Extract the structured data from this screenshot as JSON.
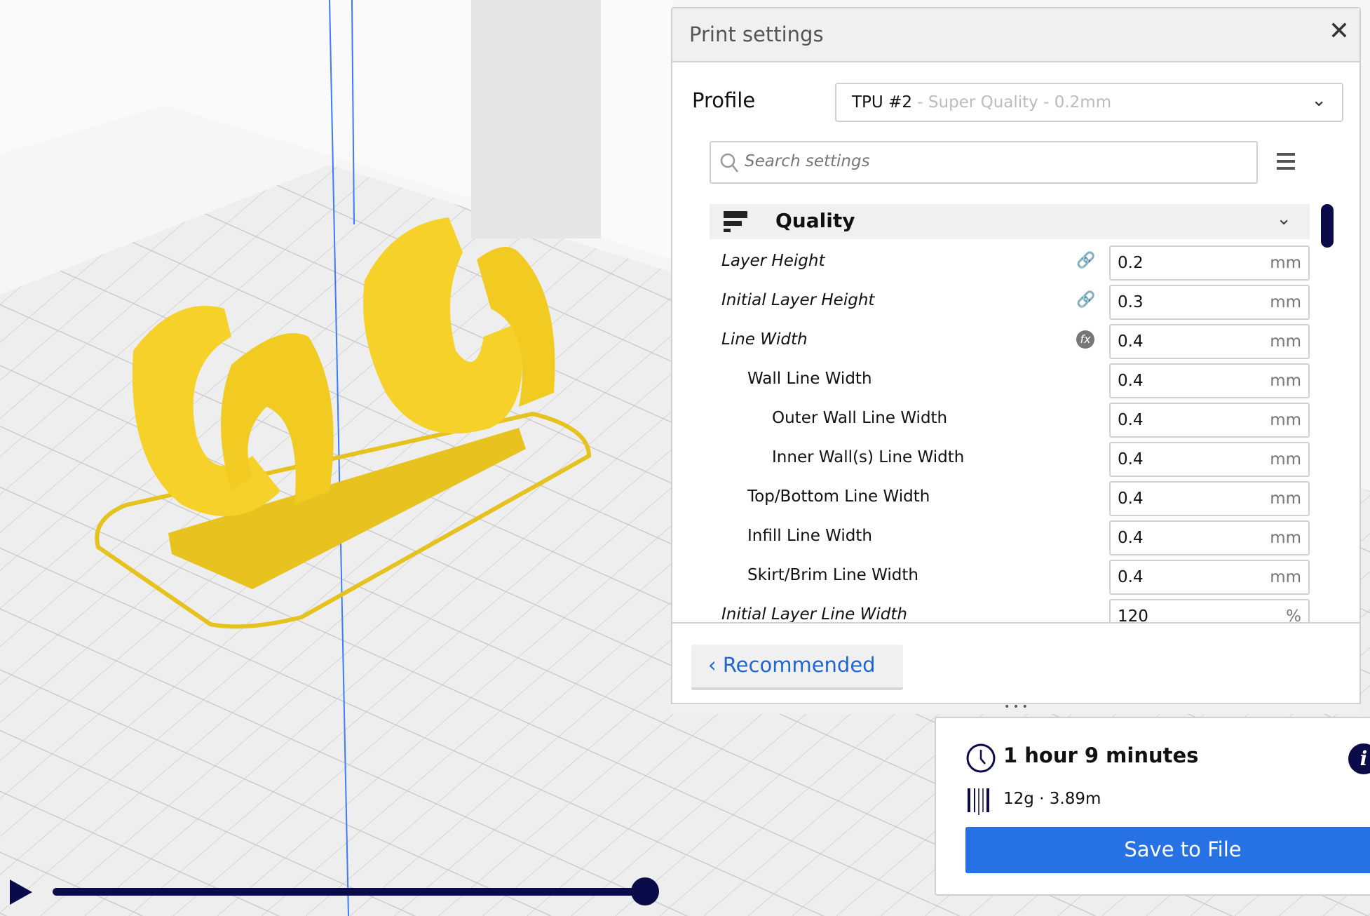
{
  "panel": {
    "title": "Print settings",
    "close_icon": "close-icon"
  },
  "profile": {
    "label": "Profile",
    "name": "TPU #2",
    "subtitle": " - Super Quality - 0.2mm"
  },
  "search": {
    "placeholder": "Search settings"
  },
  "category": {
    "title": "Quality"
  },
  "settings": [
    {
      "label": "Layer Height",
      "value": "0.2",
      "unit": "mm",
      "italic": true,
      "indent": 0,
      "icon": "link-icon"
    },
    {
      "label": "Initial Layer Height",
      "value": "0.3",
      "unit": "mm",
      "italic": true,
      "indent": 0,
      "icon": "link-icon"
    },
    {
      "label": "Line Width",
      "value": "0.4",
      "unit": "mm",
      "italic": true,
      "indent": 0,
      "icon": "function-icon"
    },
    {
      "label": "Wall Line Width",
      "value": "0.4",
      "unit": "mm",
      "italic": false,
      "indent": 1
    },
    {
      "label": "Outer Wall Line Width",
      "value": "0.4",
      "unit": "mm",
      "italic": false,
      "indent": 2
    },
    {
      "label": "Inner Wall(s) Line Width",
      "value": "0.4",
      "unit": "mm",
      "italic": false,
      "indent": 2
    },
    {
      "label": "Top/Bottom Line Width",
      "value": "0.4",
      "unit": "mm",
      "italic": false,
      "indent": 1
    },
    {
      "label": "Infill Line Width",
      "value": "0.4",
      "unit": "mm",
      "italic": false,
      "indent": 1
    },
    {
      "label": "Skirt/Brim Line Width",
      "value": "0.4",
      "unit": "mm",
      "italic": false,
      "indent": 1
    },
    {
      "label": "Initial Layer Line Width",
      "value": "120",
      "unit": "%",
      "italic": true,
      "indent": 0
    }
  ],
  "footer": {
    "recommended_label": "Recommended",
    "resize_handle": "• • •"
  },
  "summary": {
    "time": "1 hour 9 minutes",
    "material": "12g · 3.89m",
    "save_label": "Save to File"
  },
  "slider": {
    "progress": 1.0
  },
  "colors": {
    "accent": "#2671e3",
    "dark": "#0b0b4a",
    "model": "#f5d12a"
  }
}
